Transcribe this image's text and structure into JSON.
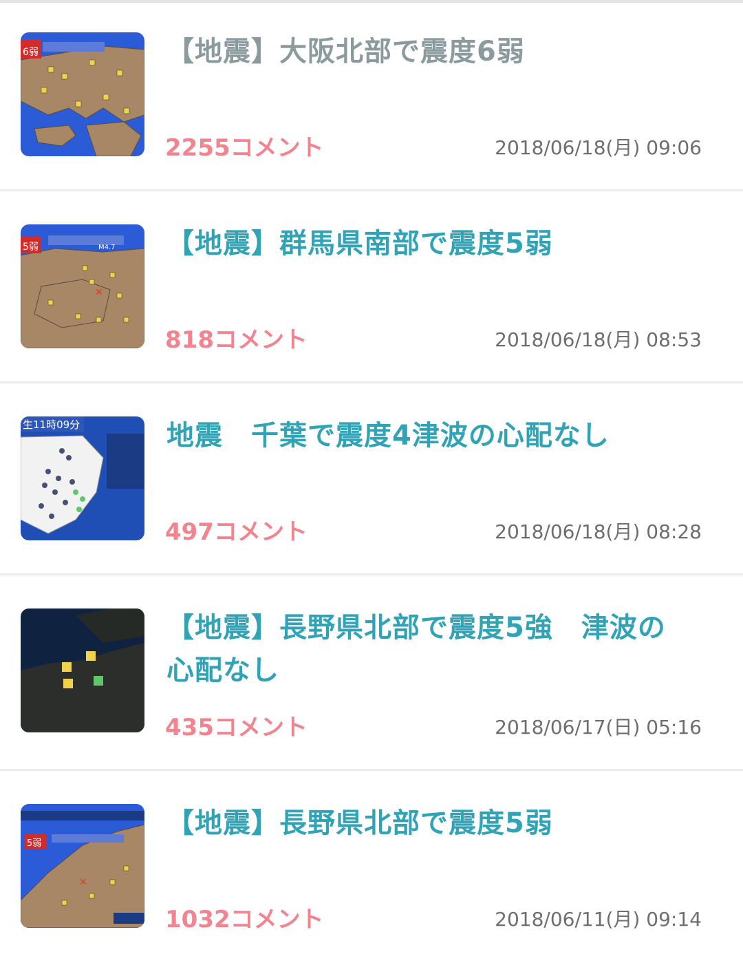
{
  "items": [
    {
      "title": "【地震】大阪北部で震度6弱",
      "comments": "2255コメント",
      "date": "2018/06/18(月) 09:06",
      "visited": true
    },
    {
      "title": "【地震】群馬県南部で震度5弱",
      "comments": "818コメント",
      "date": "2018/06/18(月) 08:53",
      "visited": false
    },
    {
      "title": "地震　千葉で震度4津波の心配なし",
      "comments": "497コメント",
      "date": "2018/06/18(月) 08:28",
      "visited": false
    },
    {
      "title": "【地震】長野県北部で震度5強　津波の心配なし",
      "comments": "435コメント",
      "date": "2018/06/17(日) 05:16",
      "visited": false
    },
    {
      "title": "【地震】長野県北部で震度5弱",
      "comments": "1032コメント",
      "date": "2018/06/11(月) 09:14",
      "visited": false
    }
  ],
  "colors": {
    "title": "#30a4b6",
    "title_visited": "#8b9a9d",
    "comments": "#f2838f",
    "date": "#6e6e6e"
  }
}
